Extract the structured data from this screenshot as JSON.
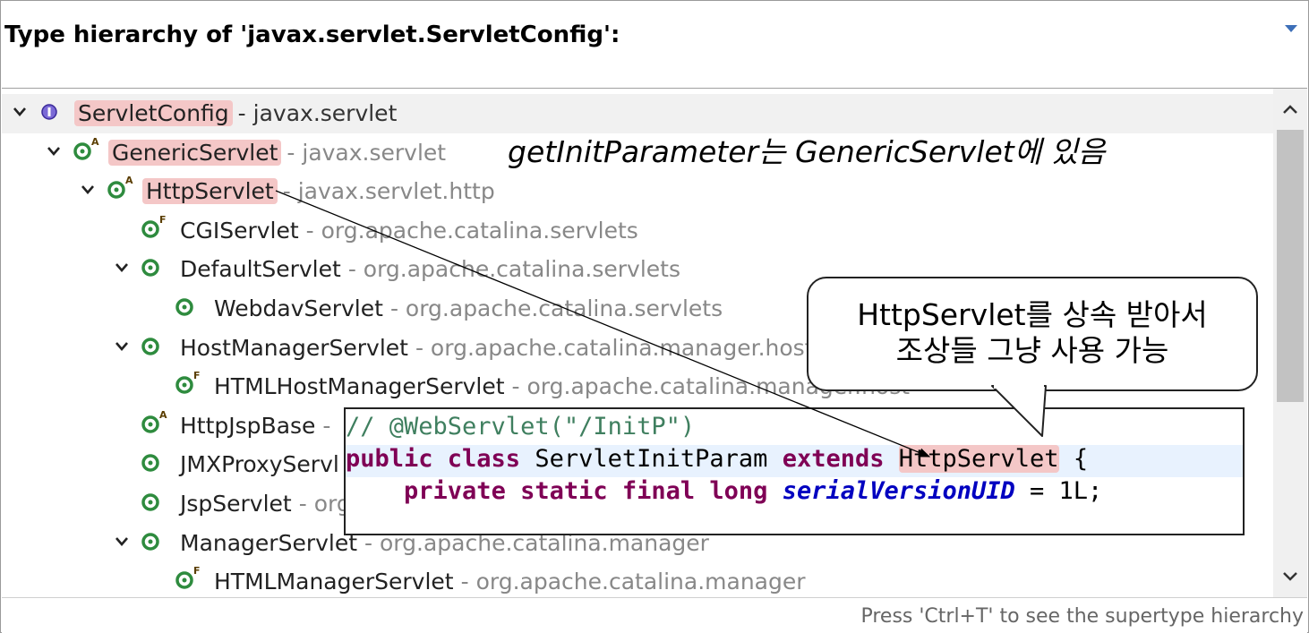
{
  "header": {
    "title": "Type hierarchy of 'javax.servlet.ServletConfig':"
  },
  "tree": [
    {
      "name": "ServletConfig",
      "pkg": "- javax.servlet",
      "type": "interface",
      "badge": "",
      "expanded": true,
      "highlight": true,
      "selected": true
    },
    {
      "name": "GenericServlet",
      "pkg": "- javax.servlet",
      "type": "class",
      "badge": "A",
      "expanded": true,
      "highlight": true
    },
    {
      "name": "HttpServlet",
      "pkg": "- javax.servlet.http",
      "type": "class",
      "badge": "A",
      "expanded": true,
      "highlight": true
    },
    {
      "name": "CGIServlet",
      "pkg": "- org.apache.catalina.servlets",
      "type": "class",
      "badge": "F"
    },
    {
      "name": "DefaultServlet",
      "pkg": "- org.apache.catalina.servlets",
      "type": "class",
      "badge": "",
      "expanded": true
    },
    {
      "name": "WebdavServlet",
      "pkg": "- org.apache.catalina.servlets",
      "type": "class",
      "badge": ""
    },
    {
      "name": "HostManagerServlet",
      "pkg": "- org.apache.catalina.manager.host",
      "type": "class",
      "badge": "",
      "expanded": true
    },
    {
      "name": "HTMLHostManagerServlet",
      "pkg": "- org.apache.catalina.manager.host",
      "type": "class",
      "badge": "F"
    },
    {
      "name": "HttpJspBase",
      "pkg": "-",
      "type": "class",
      "badge": "A"
    },
    {
      "name": "JMXProxyServl",
      "pkg": "",
      "type": "class",
      "badge": ""
    },
    {
      "name": "JspServlet",
      "pkg": "- org",
      "type": "class",
      "badge": ""
    },
    {
      "name": "ManagerServlet",
      "pkg": "- org.apache.catalina.manager",
      "type": "class",
      "badge": "",
      "expanded": true
    },
    {
      "name": "HTMLManagerServlet",
      "pkg": "- org.apache.catalina.manager",
      "type": "class",
      "badge": "F"
    }
  ],
  "annotation": {
    "note": "getInitParameter는 GenericServlet에 있음"
  },
  "callout": {
    "line1": "HttpServlet를 상속 받아서",
    "line2": "조상들 그냥 사용 가능"
  },
  "code": {
    "line1": "// @WebServlet(\"/InitP\")",
    "line2_kw1": "public class",
    "line2_name": " ServletInitParam ",
    "line2_kw2": "extends",
    "line2_super": "HttpServlet",
    "line2_end": " {",
    "line3_kw": "private static final long",
    "line3_field": "serialVersionUID",
    "line3_end": " = 1L;"
  },
  "status": {
    "text": "Press 'Ctrl+T' to see the supertype hierarchy"
  },
  "colors": {
    "class_icon": "#2e8b3e",
    "interface_icon": "#5a3fbf",
    "highlight": "#f4c7c7",
    "keyword": "#7f0055",
    "comment": "#3f7f5f",
    "field": "#0000c0"
  }
}
